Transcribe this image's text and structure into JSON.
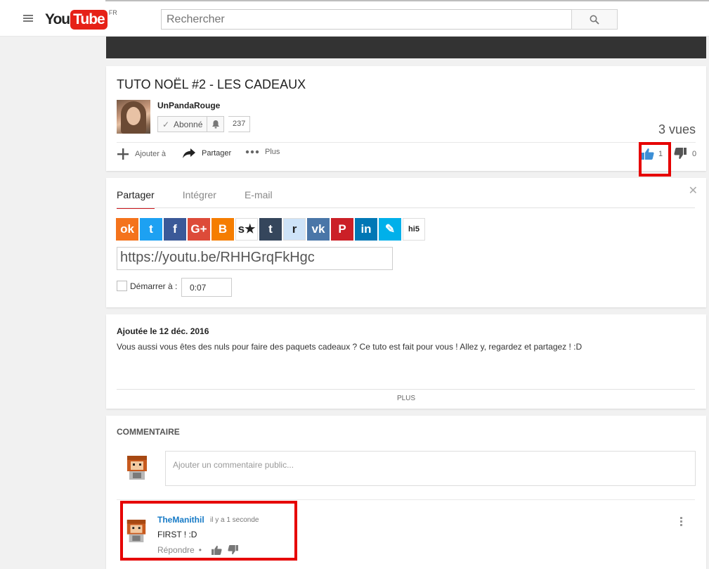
{
  "header": {
    "logo_you": "You",
    "logo_tube": "Tube",
    "region": "FR",
    "search_placeholder": "Rechercher"
  },
  "video": {
    "title": "TUTO NOËL #2 - LES CADEAUX",
    "channel": "UnPandaRouge",
    "subscribe_label": "Abonné",
    "subscriber_count": "237",
    "views": "3 vues",
    "add_label": "Ajouter à",
    "share_label": "Partager",
    "more_label": "Plus",
    "likes": "1",
    "dislikes": "0"
  },
  "share": {
    "tabs": [
      "Partager",
      "Intégrer",
      "E-mail"
    ],
    "active_tab": "Partager",
    "networks": [
      {
        "name": "odnoklassniki",
        "glyph": "ok",
        "color": "#f4731c"
      },
      {
        "name": "twitter",
        "glyph": "t",
        "color": "#1da1f2"
      },
      {
        "name": "facebook",
        "glyph": "f",
        "color": "#3b5998"
      },
      {
        "name": "google-plus",
        "glyph": "G+",
        "color": "#dd4b39"
      },
      {
        "name": "blogger",
        "glyph": "B",
        "color": "#f57d00"
      },
      {
        "name": "stumbleupon",
        "glyph": "s★",
        "color": "#ffffff"
      },
      {
        "name": "tumblr",
        "glyph": "t",
        "color": "#35465c"
      },
      {
        "name": "reddit",
        "glyph": "r",
        "color": "#cee3f8"
      },
      {
        "name": "vk",
        "glyph": "vk",
        "color": "#4a76a8"
      },
      {
        "name": "pinterest",
        "glyph": "P",
        "color": "#cb2027"
      },
      {
        "name": "linkedin",
        "glyph": "in",
        "color": "#0077b5"
      },
      {
        "name": "livejournal",
        "glyph": "✎",
        "color": "#00b0ea"
      },
      {
        "name": "hi5",
        "glyph": "hi5",
        "color": "#ffffff"
      }
    ],
    "url": "https://youtu.be/RHHGrqFkHgc",
    "start_label": "Démarrer à :",
    "start_time": "0:07"
  },
  "description": {
    "date": "Ajoutée le 12 déc. 2016",
    "text": "Vous aussi vous êtes des nuls pour faire des paquets cadeaux ? Ce tuto est fait pour vous ! Allez y, regardez et partagez ! :D",
    "more_label": "PLUS"
  },
  "comments": {
    "header": "COMMENTAIRE",
    "input_placeholder": "Ajouter un commentaire public...",
    "items": [
      {
        "author": "TheManithil",
        "time": "il y a 1 seconde",
        "text": "FIRST ! :D",
        "reply_label": "Répondre"
      }
    ]
  }
}
